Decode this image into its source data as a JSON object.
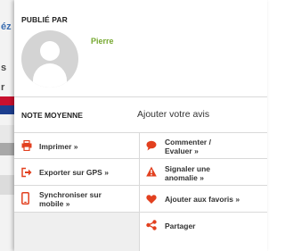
{
  "background": {
    "fragments": [
      "éz",
      "s",
      "r"
    ]
  },
  "publisher": {
    "label": "PUBLIÉ PAR",
    "name": "Pierre",
    "avatar_icon": "default-user-avatar-icon"
  },
  "rating": {
    "label": "NOTE MOYENNE",
    "add_review": "Ajouter votre avis"
  },
  "actions": {
    "print": {
      "label": "Imprimer »",
      "icon": "printer-icon"
    },
    "comment": {
      "label1": "Commenter /",
      "label2": "Evaluer »",
      "icon": "speech-bubble-icon"
    },
    "gps": {
      "label": "Exporter sur GPS »",
      "icon": "export-arrow-icon"
    },
    "report": {
      "label1": "Signaler une",
      "label2": "anomalie »",
      "icon": "warning-icon"
    },
    "mobile": {
      "label1": "Synchroniser sur",
      "label2": "mobile »",
      "icon": "smartphone-icon"
    },
    "favorite": {
      "label": "Ajouter aux favoris »",
      "icon": "heart-icon"
    },
    "share": {
      "label": "Partager",
      "icon": "share-icon"
    }
  },
  "colors": {
    "author_green": "#76a830",
    "icon_red": "#e2401f",
    "divider": "#d9d9d9"
  }
}
